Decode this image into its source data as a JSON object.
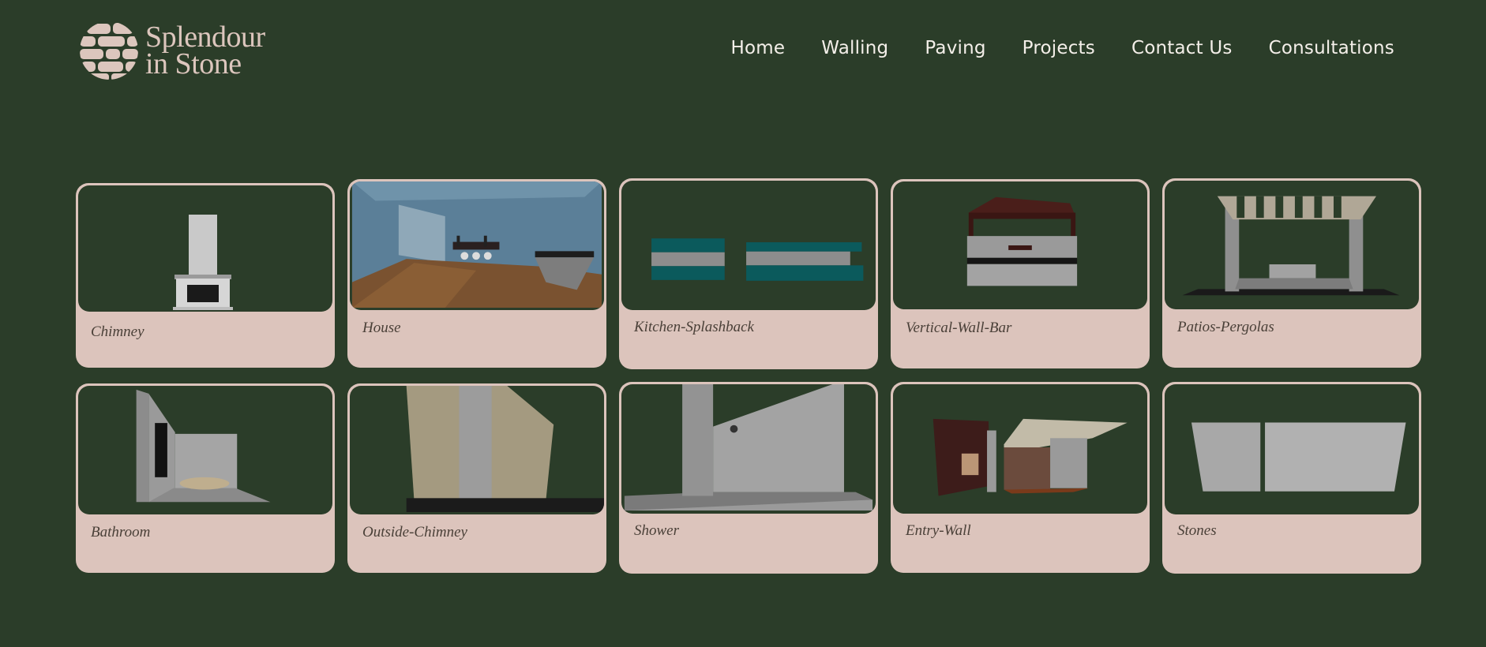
{
  "brand": {
    "line1": "Splendour",
    "line2": "in Stone"
  },
  "nav": {
    "items": [
      "Home",
      "Walling",
      "Paving",
      "Projects",
      "Contact Us",
      "Consultations"
    ]
  },
  "projects": [
    {
      "label": "Chimney",
      "icon": "chimney-image"
    },
    {
      "label": "House",
      "icon": "house-image"
    },
    {
      "label": "Kitchen-Splashback",
      "icon": "kitchen-splashback-image"
    },
    {
      "label": "Vertical-Wall-Bar",
      "icon": "vertical-wall-bar-image"
    },
    {
      "label": "Patios-Pergolas",
      "icon": "patios-pergolas-image"
    },
    {
      "label": "Bathroom",
      "icon": "bathroom-image"
    },
    {
      "label": "Outside-Chimney",
      "icon": "outside-chimney-image"
    },
    {
      "label": "Shower",
      "icon": "shower-image"
    },
    {
      "label": "Entry-Wall",
      "icon": "entry-wall-image"
    },
    {
      "label": "Stones",
      "icon": "stones-image"
    }
  ],
  "colors": {
    "background": "#2b3d29",
    "card": "#dcc4bc",
    "nav_text": "#f4efe9",
    "brand_text": "#dcc6bd"
  }
}
